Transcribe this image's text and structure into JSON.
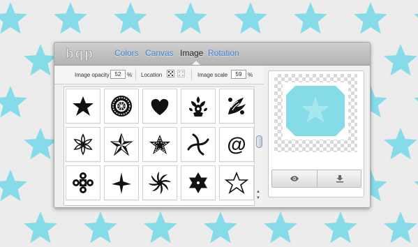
{
  "app": {
    "logo_text": "bqp"
  },
  "tabs": [
    {
      "label": "Colors",
      "active": false
    },
    {
      "label": "Canvas",
      "active": false
    },
    {
      "label": "Image",
      "active": true
    },
    {
      "label": "Rotation",
      "active": false
    }
  ],
  "options": {
    "opacity_label": "Image opacity",
    "opacity_value": "52",
    "opacity_unit": "%",
    "location_label": "Location",
    "scale_label": "Image scale",
    "scale_value": "59",
    "scale_unit": "%"
  },
  "shapes": [
    "star-filled-icon",
    "mandala-icon",
    "heart-icon",
    "fleur-ornament-icon",
    "ornament-icon",
    "flower-outline-icon",
    "nautical-star-icon",
    "dotted-star-icon",
    "swirl-arms-icon",
    "at-sign-icon",
    "cross-ornament-icon",
    "star-4point-icon",
    "spiral-sun-icon",
    "star-6point-icon",
    "star-outline-icon"
  ],
  "preview": {
    "buttons": [
      "eye-icon",
      "download-icon"
    ]
  },
  "colors": {
    "background_star": "#86dbe8",
    "tab_link": "#3c8ad6",
    "preview_shape": "#86dbe8"
  }
}
